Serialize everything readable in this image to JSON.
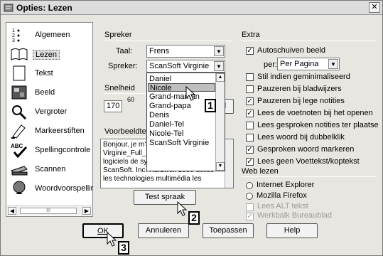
{
  "window": {
    "title": "Opties: Lezen",
    "close_glyph": "✕"
  },
  "sidebar": {
    "items": [
      {
        "label": "Algemeen",
        "icon": "numbered-list-icon"
      },
      {
        "label": "Lezen",
        "icon": "open-book-icon"
      },
      {
        "label": "Tekst",
        "icon": "document-icon"
      },
      {
        "label": "Beeld",
        "icon": "image-icon"
      },
      {
        "label": "Vergroter",
        "icon": "magnifier-icon"
      },
      {
        "label": "Markeerstiften",
        "icon": "highlighter-icon"
      },
      {
        "label": "Spellingcontrole",
        "icon": "spellcheck-icon"
      },
      {
        "label": "Scannen",
        "icon": "scanner-icon"
      },
      {
        "label": "Woordvoorspellir",
        "icon": "globe-icon"
      }
    ],
    "scroll_thumb": "III"
  },
  "spreker": {
    "group_title": "Spreker",
    "taal_label": "Taal:",
    "taal_value": "Frens",
    "spreker_label": "Spreker:",
    "spreker_value": "ScanSoft Virginie",
    "options": [
      "Daniel",
      "Nicole",
      "Grand-maman",
      "Grand-papa",
      "Denis",
      "Daniel-Tel",
      "Nicole-Tel",
      "ScanSoft Virginie"
    ],
    "highlighted": "Nicole"
  },
  "snelheid": {
    "label": "Snelheid",
    "value": "170",
    "tick": "60",
    "button_label": "d"
  },
  "voorbeeld": {
    "label": "Voorbeeldtek",
    "text": "Bonjour, je m'appelle ScanSoft Virginie_Full_22kHz. Une voix des logiciels de synthèse vocale de ScanSoft. Inc. Kurzweil 3000 utilise les technologies multimédia les",
    "test_button": "Test spraak"
  },
  "extra": {
    "group_title": "Extra",
    "autoschuiven": {
      "label": "Autoschuiven beeld",
      "checked": true
    },
    "per_label": "per:",
    "per_value": "Per Pagina",
    "options": [
      {
        "label": "Stil indien geminimaliseerd",
        "checked": false
      },
      {
        "label": "Pauzeren bij bladwijzers",
        "checked": false
      },
      {
        "label": "Pauzeren bij lege notities",
        "checked": true
      },
      {
        "label": "Lees de voetnoten bij het openen",
        "checked": true
      },
      {
        "label": "Lees gesproken notities ter plaatse",
        "checked": false
      },
      {
        "label": "Lees woord bij dubbelklik",
        "checked": false
      },
      {
        "label": "Gesproken woord markeren",
        "checked": true
      },
      {
        "label": "Lees geen Voettekst/koptekst",
        "checked": true
      }
    ]
  },
  "web": {
    "group_title": "Web lezen",
    "radios": [
      {
        "label": "Internet Explorer",
        "selected": false
      },
      {
        "label": "Mozilla Firefox",
        "selected": false
      }
    ],
    "disabled_checks": [
      {
        "label": "Lees ALT tekst",
        "checked": false
      },
      {
        "label": "Werkbalk Bureaublad",
        "checked": true
      }
    ]
  },
  "buttons": {
    "ok": "OK",
    "cancel": "Annuleren",
    "apply": "Toepassen",
    "help": "Help"
  },
  "callouts": [
    "1",
    "2",
    "3"
  ]
}
